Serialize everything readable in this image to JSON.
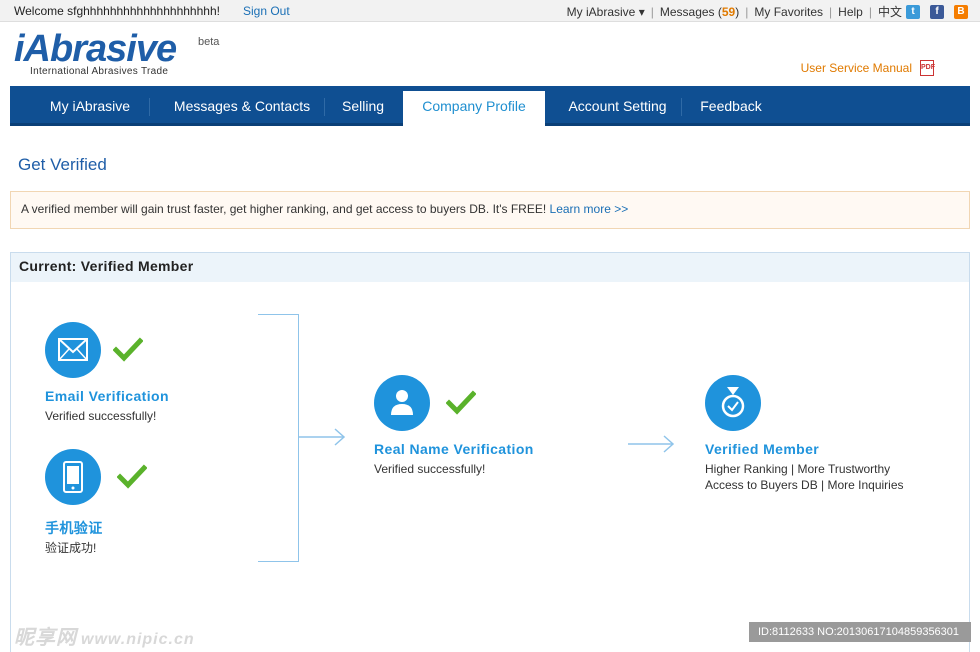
{
  "topbar": {
    "welcome": "Welcome sfghhhhhhhhhhhhhhhhhhhh!",
    "signout": "Sign Out",
    "my_iabrasive": "My iAbrasive ▾",
    "messages_label": "Messages (",
    "messages_count": "59",
    "messages_close": ")",
    "favorites": "My Favorites",
    "help": "Help",
    "language": "中文",
    "social_icons": [
      "twitter-icon",
      "facebook-icon",
      "blogger-icon"
    ]
  },
  "header": {
    "brand": "iAbrasive",
    "beta": "beta",
    "tagline": "International Abrasives Trade",
    "manual": "User Service Manual",
    "manual_icon": "pdf-icon"
  },
  "nav": {
    "tabs": [
      {
        "label": "My iAbrasive"
      },
      {
        "label": "Messages & Contacts"
      },
      {
        "label": "Selling"
      },
      {
        "label": "Company Profile",
        "active": true
      },
      {
        "label": "Account Setting"
      },
      {
        "label": "Feedback"
      }
    ]
  },
  "page": {
    "title": "Get Verified",
    "notice": "A verified member will gain trust faster, get higher ranking, and get access to buyers DB. It's FREE! ",
    "learn_more": "Learn more >>"
  },
  "panel": {
    "title": "Current: Verified Member",
    "steps": [
      {
        "icon": "envelope-icon",
        "title": "Email Verification",
        "desc": "Verified successfully!",
        "status_icon": "check-icon"
      },
      {
        "icon": "mobile-phone-icon",
        "title": "手机验证",
        "desc": "验证成功!",
        "status_icon": "check-icon"
      },
      {
        "icon": "user-icon",
        "title": "Real Name Verification",
        "desc": "Verified successfully!",
        "status_icon": "check-icon"
      },
      {
        "icon": "medal-icon",
        "title": "Verified Member",
        "desc_line1": "Higher Ranking | More Trustworthy",
        "desc_line2": "Access to Buyers DB | More Inquiries"
      }
    ]
  },
  "watermark": {
    "text": "昵享网",
    "url": "www.nipic.cn",
    "id": "ID:8112633 NO:20130617104859356301"
  },
  "colors": {
    "nav_bg": "#0f4f92",
    "accent_blue": "#1f93dc",
    "check_green": "#5ab22b",
    "orange": "#e07a00"
  }
}
